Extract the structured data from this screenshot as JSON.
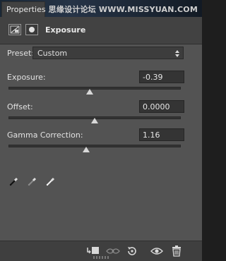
{
  "panel": {
    "tab_label": "Properties",
    "watermark": "思缘设计论坛 WWW.MISSYUAN.COM",
    "title": "Exposure",
    "preset": {
      "label": "Preset:",
      "value": "Custom"
    },
    "exposure": {
      "label": "Exposure:",
      "value": "-0.39"
    },
    "offset": {
      "label": "Offset:",
      "value": "0.0000"
    },
    "gamma": {
      "label": "Gamma Correction:",
      "value": "1.16"
    }
  },
  "sliders": {
    "exposure_fraction": 0.47,
    "offset_fraction": 0.5,
    "gamma_fraction": 0.45
  },
  "icons": {
    "header": [
      "adjustment-layer-icon",
      "mask-icon"
    ],
    "eyedroppers": [
      "black-eyedropper-icon",
      "gray-eyedropper-icon",
      "white-eyedropper-icon"
    ],
    "bottom": [
      "clip-to-layer-icon",
      "view-previous-state-icon",
      "reset-icon",
      "visibility-eye-icon",
      "delete-trash-icon"
    ]
  }
}
